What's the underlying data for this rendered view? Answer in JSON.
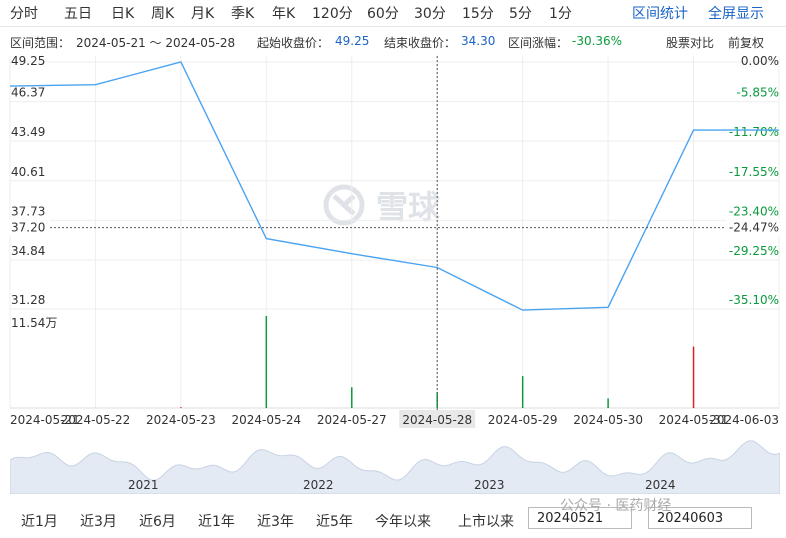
{
  "tabs": [
    "分时",
    "五日",
    "日K",
    "周K",
    "月K",
    "季K",
    "年K",
    "120分",
    "60分",
    "30分",
    "15分",
    "5分",
    "1分"
  ],
  "right_tabs": [
    "区间统计",
    "全屏显示"
  ],
  "info": {
    "range_label": "区间范围：",
    "range_value": "2024-05-21 ～ 2024-05-28",
    "start_label": "起始收盘价：",
    "start_value": "49.25",
    "end_label": "结束收盘价：",
    "end_value": "34.30",
    "change_label": "区间涨幅：",
    "change_value": "-30.36%",
    "compare": "股票对比",
    "adjust": "前复权"
  },
  "watermark": "雪球",
  "cursor": {
    "price": "37.20",
    "pct": "-24.47%",
    "date": "2024-05-28"
  },
  "volume_label": "11.54万",
  "bottom": {
    "ranges": [
      "近1月",
      "近3月",
      "近6月",
      "近1年",
      "近3年",
      "近5年",
      "今年以来",
      "上市以来"
    ],
    "start_date": "20240521",
    "end_date": "20240603",
    "footer_watermark": "公众号 · 医药财经"
  },
  "mini_years": [
    "2021",
    "2022",
    "2023",
    "2024"
  ],
  "colors": {
    "line": "#4aa3f0",
    "up": "#e02020",
    "down": "#0a9a3c",
    "accent": "#1a64c8"
  },
  "chart_data": {
    "type": "line",
    "x": [
      "2024-05-21",
      "2024-05-22",
      "2024-05-23",
      "2024-05-24",
      "2024-05-27",
      "2024-05-28",
      "2024-05-29",
      "2024-05-30",
      "2024-05-31",
      "2024-06-03"
    ],
    "series": [
      {
        "values": [
          47.5,
          47.6,
          49.25,
          36.4,
          35.3,
          34.3,
          31.2,
          31.4,
          44.3,
          44.3
        ]
      }
    ],
    "volume": [
      0,
      0,
      0.1,
      11.54,
      2.6,
      2.0,
      4.0,
      1.2,
      7.7,
      0
    ],
    "volume_dir": [
      "down",
      "down",
      "up",
      "down",
      "down",
      "down",
      "down",
      "down",
      "up",
      "down"
    ],
    "ylim": [
      31.28,
      49.25
    ],
    "y_ticks": [
      "49.25",
      "46.37",
      "43.49",
      "40.61",
      "37.73",
      "34.84",
      "31.28"
    ],
    "pct_ticks": [
      "0.00%",
      "-5.85%",
      "-11.70%",
      "-17.55%",
      "-23.40%",
      "-29.25%",
      "-35.10%"
    ]
  }
}
